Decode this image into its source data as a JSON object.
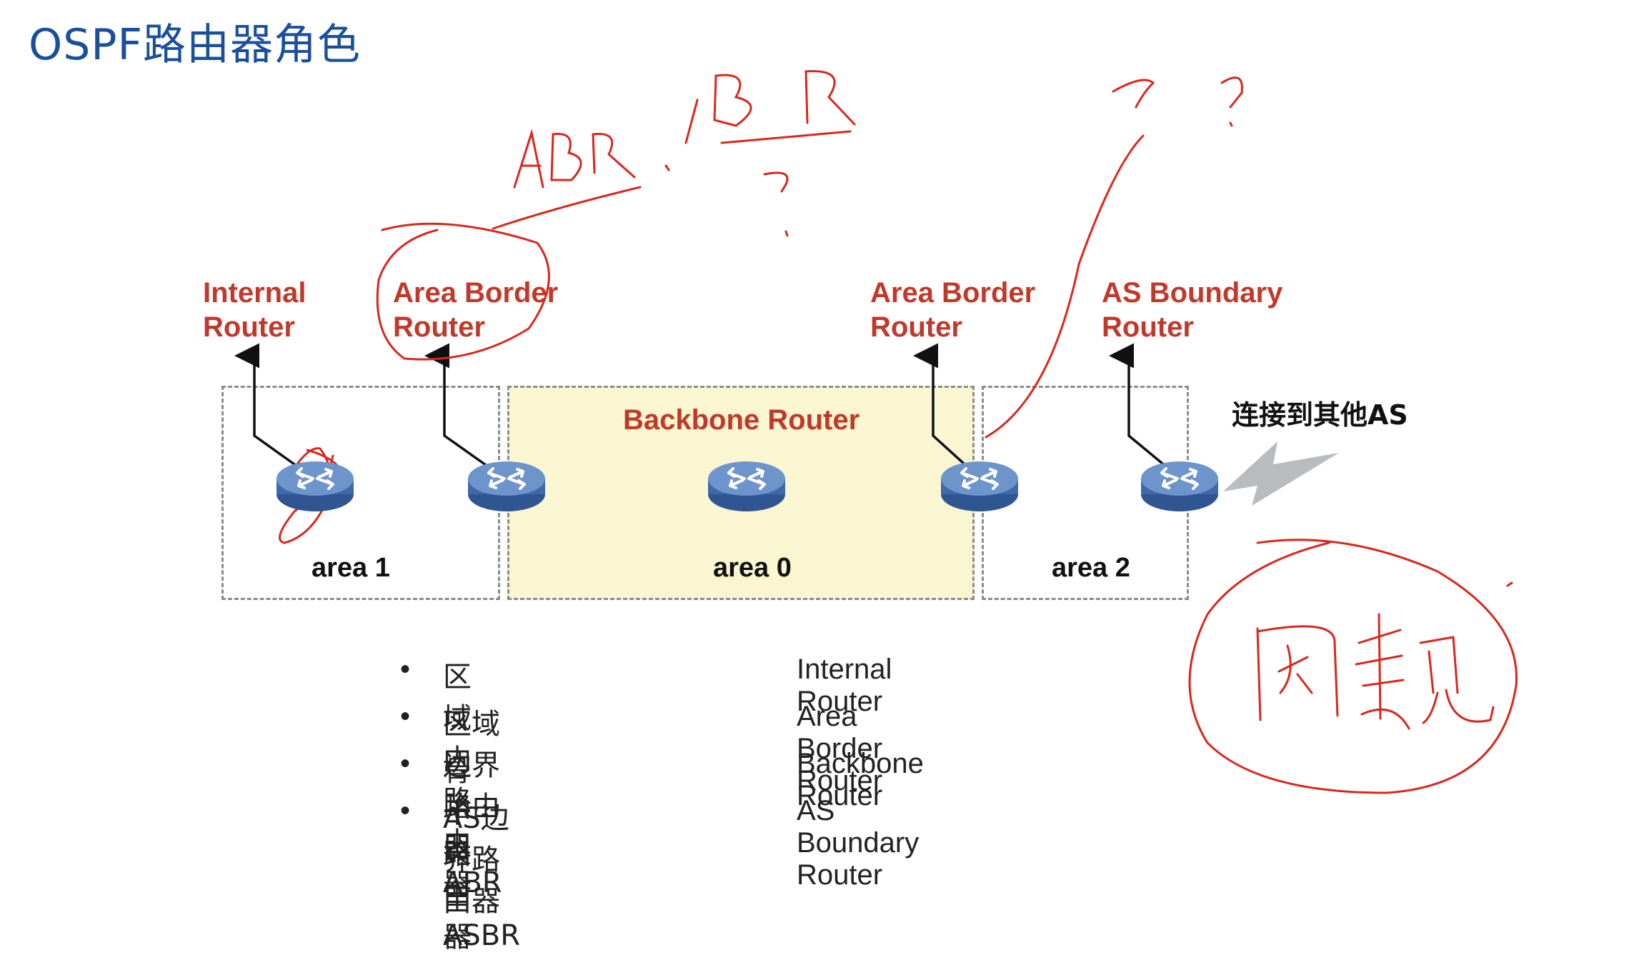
{
  "title": "OSPF路由器角色",
  "areas": [
    {
      "label": "area 1"
    },
    {
      "label": "area 0"
    },
    {
      "label": "area 2"
    }
  ],
  "backbone_label": "Backbone Router",
  "roles": {
    "internal": [
      "Internal",
      "Router"
    ],
    "abr_left": [
      "Area Border",
      "Router"
    ],
    "abr_right": [
      "Area Border",
      "Router"
    ],
    "asbr": [
      "AS Boundary",
      "Router"
    ]
  },
  "other_as_label": "连接到其他AS",
  "legend": [
    {
      "bullet": "•",
      "zh": "区域内路由器",
      "en": "Internal Router"
    },
    {
      "bullet": "•",
      "zh": "区域边界路由器ABR",
      "en": "Area Border Router"
    },
    {
      "bullet": "•",
      "zh": "骨干路由器",
      "en": "Backbone Router"
    },
    {
      "bullet": "•",
      "zh": "AS边界路由器ASBR",
      "en": "AS Boundary Router"
    }
  ],
  "colors": {
    "title": "#1a4f9c",
    "role_label": "#c0392b",
    "backbone_fill": "#fbf6d2",
    "annotation": "#d8281e",
    "router_body": "#4a74b3"
  },
  "icons": [
    "router-icon",
    "lightning-icon",
    "arrow-up-icon"
  ]
}
